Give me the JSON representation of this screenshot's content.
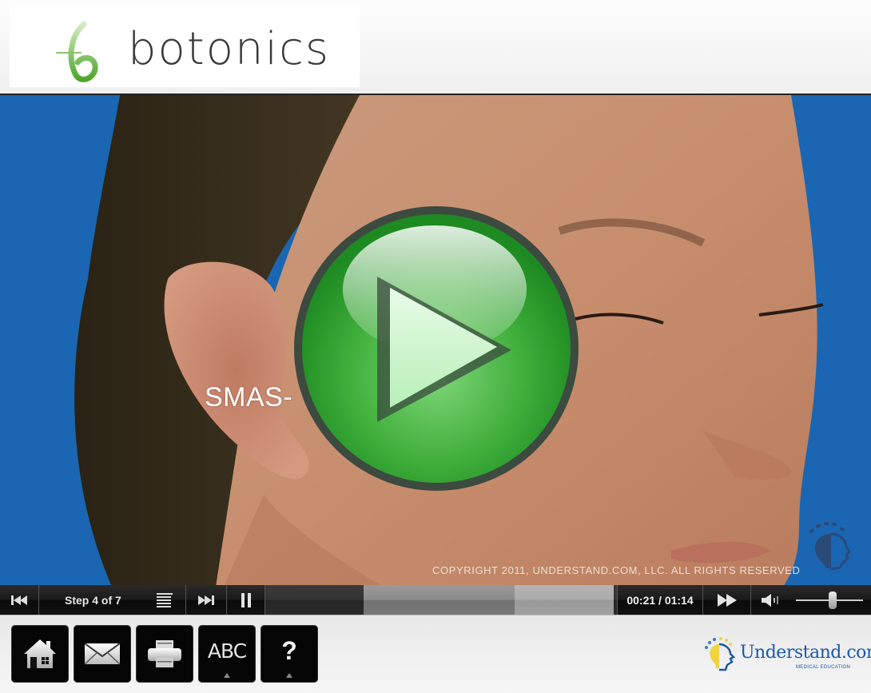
{
  "header": {
    "brand_name": "botonics",
    "brand_color": "#5aa832"
  },
  "video": {
    "caption": "SMAS-",
    "copyright": "COPYRIGHT 2011, UNDERSTAND.COM, LLC. ALL RIGHTS RESERVED",
    "play_overlay_icon": "play-icon",
    "play_overlay_color": "#2e9a2e",
    "background_color": "#1a66b2"
  },
  "controls": {
    "prev_icon": "skip-back-icon",
    "step_label": "Step 4 of 7",
    "chapters_icon": "list-icon",
    "next_icon": "skip-forward-icon",
    "pause_icon": "pause-icon",
    "progress": {
      "played_fraction": 0.28,
      "buffered_fraction": 0.71,
      "loaded_fraction": 0.99
    },
    "time": "00:21 / 01:14",
    "ff_icon": "fast-forward-icon",
    "volume_icon": "volume-icon",
    "volume_fraction": 0.55
  },
  "toolbar": {
    "buttons": [
      {
        "name": "home",
        "icon": "home-icon"
      },
      {
        "name": "email",
        "icon": "envelope-icon"
      },
      {
        "name": "print",
        "icon": "printer-icon"
      },
      {
        "name": "glossary",
        "label": "ABC"
      },
      {
        "name": "help",
        "label": "?"
      }
    ],
    "partner_name": "Understand.com",
    "partner_tm": "™",
    "partner_sub": "MEDICAL EDUCATION"
  }
}
